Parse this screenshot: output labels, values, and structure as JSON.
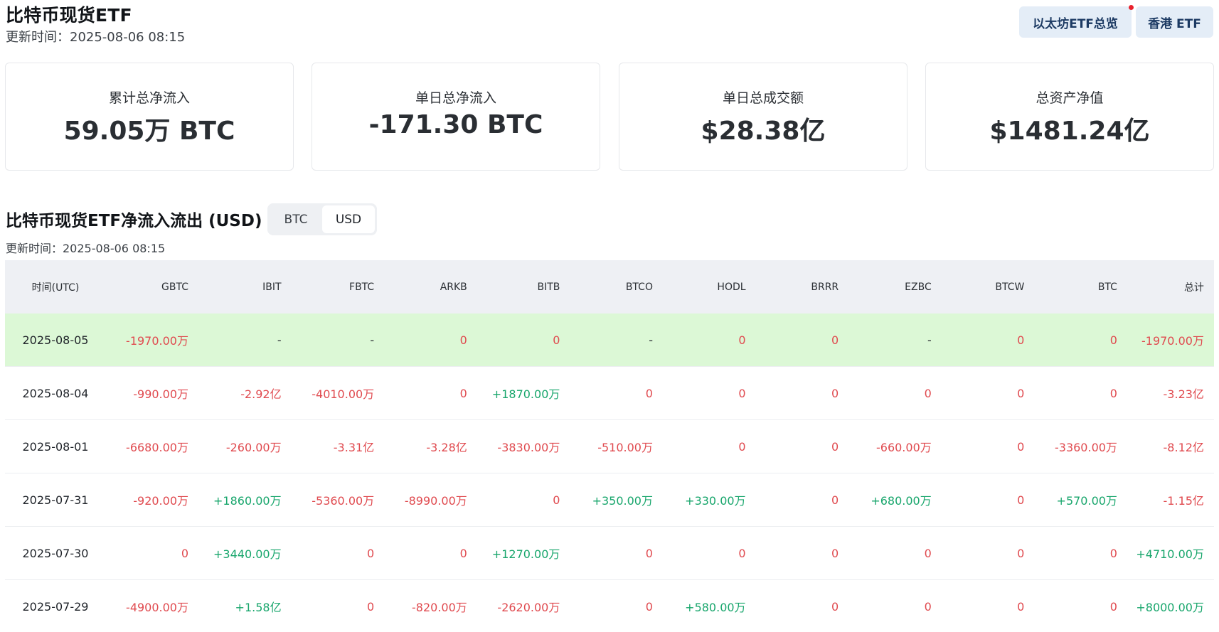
{
  "header": {
    "title": "比特币现货ETF",
    "updated": "更新时间：2025-08-06 08:15",
    "eth_button": "以太坊ETF总览",
    "hk_button": "香港 ETF"
  },
  "stats": [
    {
      "label": "累计总净流入",
      "value": "59.05万 BTC"
    },
    {
      "label": "单日总净流入",
      "value": "-171.30 BTC"
    },
    {
      "label": "单日总成交额",
      "value": "$28.38亿"
    },
    {
      "label": "总资产净值",
      "value": "$1481.24亿"
    }
  ],
  "section": {
    "title": "比特币现货ETF净流入流出 (USD)",
    "updated": "更新时间：2025-08-06 08:15",
    "toggle": {
      "btc": "BTC",
      "usd": "USD",
      "selected": "USD"
    }
  },
  "colors": {
    "negative": "#e04a4f",
    "positive": "#18a66c",
    "highlight": "#dcf8d6"
  },
  "table": {
    "headers": [
      "时间(UTC)",
      "GBTC",
      "IBIT",
      "FBTC",
      "ARKB",
      "BITB",
      "BTCO",
      "HODL",
      "BRRR",
      "EZBC",
      "BTCW",
      "BTC",
      "总计"
    ],
    "rows": [
      [
        "2025-08-05",
        "-1970.00万",
        "-",
        "-",
        "0",
        "0",
        "-",
        "0",
        "0",
        "-",
        "0",
        "0",
        "-1970.00万"
      ],
      [
        "2025-08-04",
        "-990.00万",
        "-2.92亿",
        "-4010.00万",
        "0",
        "+1870.00万",
        "0",
        "0",
        "0",
        "0",
        "0",
        "0",
        "-3.23亿"
      ],
      [
        "2025-08-01",
        "-6680.00万",
        "-260.00万",
        "-3.31亿",
        "-3.28亿",
        "-3830.00万",
        "-510.00万",
        "0",
        "0",
        "-660.00万",
        "0",
        "-3360.00万",
        "-8.12亿"
      ],
      [
        "2025-07-31",
        "-920.00万",
        "+1860.00万",
        "-5360.00万",
        "-8990.00万",
        "0",
        "+350.00万",
        "+330.00万",
        "0",
        "+680.00万",
        "0",
        "+570.00万",
        "-1.15亿"
      ],
      [
        "2025-07-30",
        "0",
        "+3440.00万",
        "0",
        "0",
        "+1270.00万",
        "0",
        "0",
        "0",
        "0",
        "0",
        "0",
        "+4710.00万"
      ],
      [
        "2025-07-29",
        "-4900.00万",
        "+1.58亿",
        "0",
        "-820.00万",
        "-2620.00万",
        "0",
        "+580.00万",
        "0",
        "0",
        "0",
        "0",
        "+8000.00万"
      ]
    ]
  }
}
